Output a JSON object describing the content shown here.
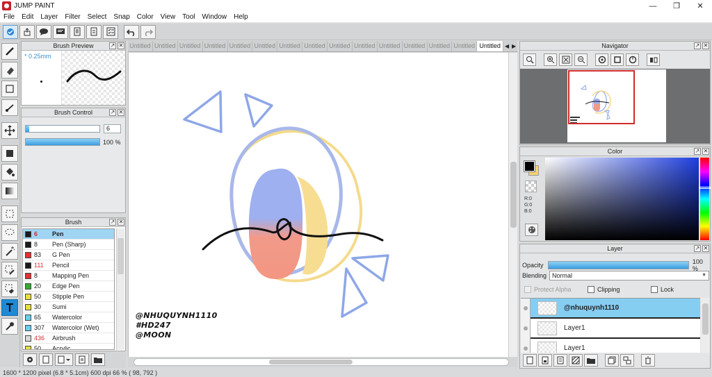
{
  "app": {
    "title": "JUMP PAINT"
  },
  "menu": [
    "File",
    "Edit",
    "Layer",
    "Filter",
    "Select",
    "Snap",
    "Color",
    "View",
    "Tool",
    "Window",
    "Help"
  ],
  "tabs": {
    "inactive_label": "Untitled",
    "active_label": "Untitled",
    "count": 15
  },
  "brush_preview": {
    "title": "Brush Preview",
    "size": "* 0.25mm"
  },
  "brush_control": {
    "title": "Brush Control",
    "size_value": "6",
    "size_fraction": 0.05,
    "density_label": "100 %",
    "density_fraction": 1.0
  },
  "brush_panel": {
    "title": "Brush",
    "items": [
      {
        "size": "6",
        "name": "Pen",
        "color": "#1a1a1a",
        "size_red": true,
        "selected": true
      },
      {
        "size": "8",
        "name": "Pen (Sharp)",
        "color": "#1a1a1a"
      },
      {
        "size": "83",
        "name": "G Pen",
        "color": "#e03131"
      },
      {
        "size": "111",
        "name": "Pencil",
        "color": "#1a1a1a",
        "size_red": true
      },
      {
        "size": "8",
        "name": "Mapping Pen",
        "color": "#e03131"
      },
      {
        "size": "20",
        "name": "Edge Pen",
        "color": "#2fae2f"
      },
      {
        "size": "50",
        "name": "Stipple Pen",
        "color": "#e8e03a"
      },
      {
        "size": "30",
        "name": "Sumi",
        "color": "#e8e03a"
      },
      {
        "size": "65",
        "name": "Watercolor",
        "color": "#66cfee"
      },
      {
        "size": "307",
        "name": "Watercolor (Wet)",
        "color": "#66cfee"
      },
      {
        "size": "436",
        "name": "Airbrush",
        "color": "#d8d8d8",
        "size_red": true
      },
      {
        "size": "50",
        "name": "Acrylic",
        "color": "#e8e03a"
      }
    ]
  },
  "canvas": {
    "watermark": [
      "@NHUQUYNH1110",
      "#HD247",
      "@MOON"
    ]
  },
  "navigator": {
    "title": "Navigator"
  },
  "color_panel": {
    "title": "Color",
    "r": "R:0",
    "g": "G:0",
    "b": "B:0",
    "fg": "#000000",
    "bg": "#f5d273"
  },
  "layer_panel": {
    "title": "Layer",
    "opacity_label": "Opacity",
    "opacity_value": "100 %",
    "blending_label": "Blending",
    "blending_value": "Normal",
    "protect_alpha": "Protect Alpha",
    "clipping": "Clipping",
    "lock": "Lock",
    "layers": [
      {
        "name": "@nhuquynh1110",
        "selected": true
      },
      {
        "name": "Layer1"
      },
      {
        "name": "Layer1"
      }
    ]
  },
  "status": {
    "text": "1600 * 1200 pixel   (6.8 * 5.1cm)   600 dpi   66 %   ( 98, 792 )"
  }
}
